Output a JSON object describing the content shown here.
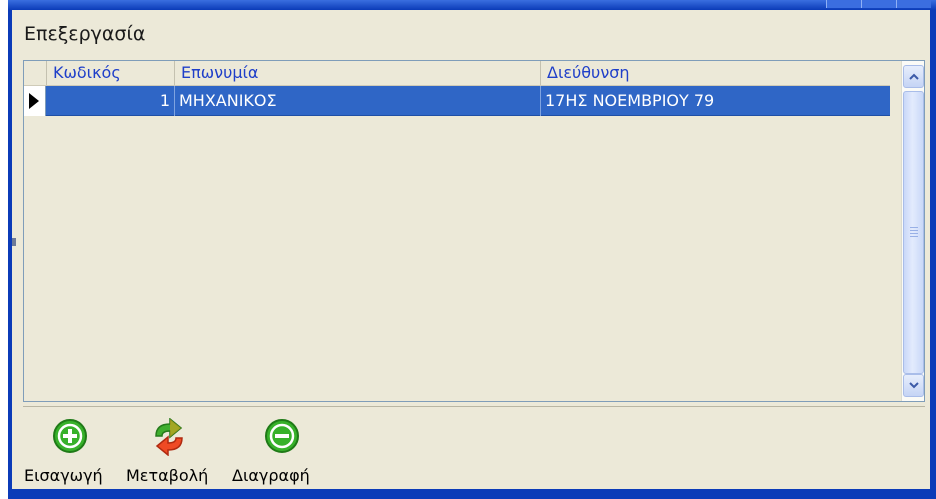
{
  "panel": {
    "title": "Επεξεργασία"
  },
  "grid": {
    "columns": [
      "Κωδικός",
      "Επωνυμία",
      "Διεύθυνση"
    ],
    "rows": [
      {
        "code": "1",
        "name": "ΜΗΧΑΝΙΚΟΣ",
        "address": "17ΗΣ ΝΟΕΜΒΡΙΟΥ 79",
        "selected": true
      }
    ]
  },
  "toolbar": {
    "insert_label": "Εισαγωγή",
    "modify_label": "Μεταβολή",
    "delete_label": "Διαγραφή"
  },
  "icons": {
    "insert": "plus-circle-icon",
    "modify": "refresh-arrows-icon",
    "delete": "minus-circle-icon"
  },
  "colors": {
    "selection": "#2f66c6",
    "header_text": "#1f3fc9",
    "window_frame": "#0b3bb8",
    "panel_bg": "#ece9d8"
  }
}
